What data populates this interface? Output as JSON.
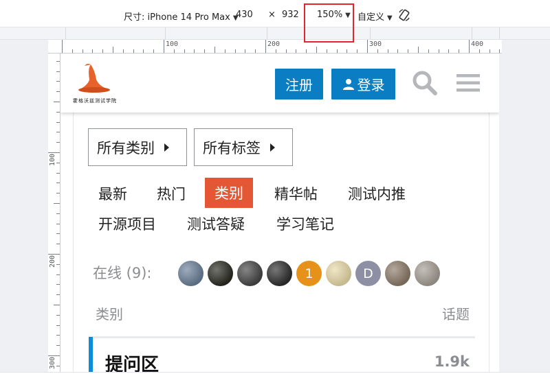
{
  "toolbar": {
    "device_label": "尺寸: iPhone 14 Pro Max",
    "width": "430",
    "times": "×",
    "height": "932",
    "zoom": "150%",
    "preset": "自定义"
  },
  "ruler": {
    "h_labels": [
      "100",
      "200",
      "300",
      "400"
    ],
    "v_labels": [
      "100",
      "200",
      "300"
    ]
  },
  "site": {
    "logo_text": "霍格沃兹测试学院",
    "register": "注册",
    "login": "登录",
    "search_icon": "search-icon",
    "menu_icon": "hamburger-icon"
  },
  "filters": {
    "categories": "所有类别",
    "tags": "所有标签"
  },
  "nav": {
    "items": [
      "最新",
      "热门",
      "类别",
      "精华帖",
      "测试内推",
      "开源项目",
      "测试答疑",
      "学习笔记"
    ],
    "active": "类别"
  },
  "online": {
    "label": "在线 (9):",
    "avatars": [
      {
        "kind": "photo",
        "color": "#6a7f98",
        "text": ""
      },
      {
        "kind": "photo",
        "color": "#2a2a22",
        "text": ""
      },
      {
        "kind": "photo",
        "color": "#454545",
        "text": ""
      },
      {
        "kind": "photo",
        "color": "#2e2e2e",
        "text": ""
      },
      {
        "kind": "letter",
        "color": "#e6911a",
        "text": "1"
      },
      {
        "kind": "photo",
        "color": "#e8d9a8",
        "text": ""
      },
      {
        "kind": "letter",
        "color": "#8d8fa4",
        "text": "D"
      },
      {
        "kind": "photo",
        "color": "#8a7a68",
        "text": ""
      },
      {
        "kind": "photo",
        "color": "#a49d94",
        "text": ""
      }
    ]
  },
  "table": {
    "col_category": "类别",
    "col_topics": "话题",
    "rows": [
      {
        "name": "提问区",
        "count": "1.9k",
        "color": "#0b8dd8"
      }
    ]
  },
  "colors": {
    "primary": "#0b7ec3",
    "active_tab": "#e45735",
    "highlight_box": "#e0262a"
  }
}
